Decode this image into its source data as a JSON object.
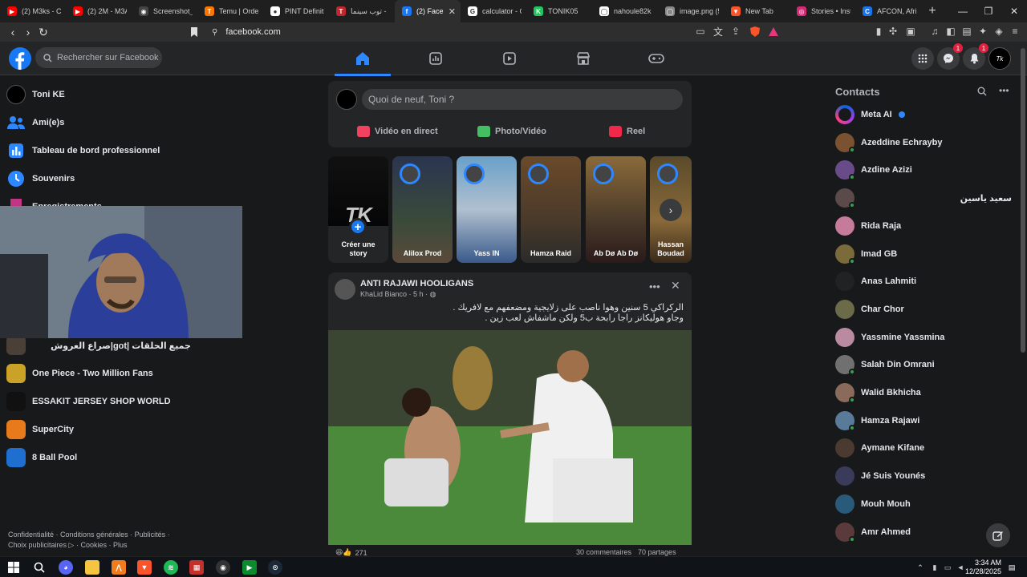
{
  "browser": {
    "tabs": [
      {
        "label": "(2) M3ks - CA",
        "color": "#ff0000",
        "glyph": "▶"
      },
      {
        "label": "(2) 2M - M3A",
        "color": "#ff0000",
        "glyph": "▶"
      },
      {
        "label": "Screenshot_2",
        "color": "#444444",
        "glyph": "◉"
      },
      {
        "label": "Temu | Orders",
        "color": "#fb7701",
        "glyph": "T"
      },
      {
        "label": "PINT Definitio",
        "color": "#ffffff",
        "glyph": "●"
      },
      {
        "label": "توب سينما -",
        "color": "#c0262d",
        "glyph": "T"
      },
      {
        "label": "(2) Faceb",
        "color": "#1877f2",
        "glyph": "f",
        "active": true
      },
      {
        "label": "calculator - G",
        "color": "#ffffff",
        "glyph": "G"
      },
      {
        "label": "TONIK05",
        "color": "#22c55e",
        "glyph": "K"
      },
      {
        "label": "nahoule82k -",
        "color": "#ffffff",
        "glyph": "◯"
      },
      {
        "label": "image.png (5",
        "color": "#888888",
        "glyph": "◯"
      },
      {
        "label": "New Tab",
        "color": "#fb542b",
        "glyph": "▼"
      },
      {
        "label": "Stories • Insta",
        "color": "#d62976",
        "glyph": "◎"
      },
      {
        "label": "AFCON, Africa",
        "color": "#1a73e8",
        "glyph": "C"
      }
    ],
    "url": "facebook.com"
  },
  "header": {
    "search_placeholder": "Rechercher sur Facebook",
    "messenger_badge": "1",
    "notifications_badge": "1"
  },
  "sidebar": {
    "items": [
      {
        "label": "Toni KE",
        "icon": "profile-avatar"
      },
      {
        "label": "Ami(e)s",
        "icon": "friends-icon"
      },
      {
        "label": "Tableau de bord professionnel",
        "icon": "dashboard-icon"
      },
      {
        "label": "Souvenirs",
        "icon": "memories-icon"
      },
      {
        "label": "Enregistrements",
        "icon": "saved-icon"
      }
    ],
    "shortcuts": [
      {
        "label": "صراع العروش|got| جميع الحلقات"
      },
      {
        "label": "One Piece - Two Million Fans"
      },
      {
        "label": "ESSAKIT JERSEY SHOP WORLD"
      },
      {
        "label": "SuperCity"
      },
      {
        "label": "8 Ball Pool"
      }
    ],
    "footer_line1": "Confidentialité · Conditions générales · Publicités ·",
    "footer_line2": "Choix publicitaires ▷ · Cookies · Plus"
  },
  "composer": {
    "placeholder": "Quoi de neuf, Toni ?",
    "live_label": "Vidéo en direct",
    "photo_label": "Photo/Vidéo",
    "reel_label": "Reel"
  },
  "stories": [
    {
      "name": "Créer une story",
      "create": true
    },
    {
      "name": "Alilox Prod"
    },
    {
      "name": "Yass IN"
    },
    {
      "name": "Hamza Raid"
    },
    {
      "name": "Ab Dø Ab Dø"
    },
    {
      "name": "Hassan Boudad"
    }
  ],
  "post": {
    "page_name": "ANTI RAJAWI HOOLIGANS",
    "author": "KhaLid Bianco · 5 h ·",
    "text_line1": "الركراكي 5 سنين وهوا ناصب على زلايجية ومضعفهم مع لافريك .",
    "text_line2": "وجاو هوليكانز راجا رابحة ب5 ولكن ماشفاش لعب زين .",
    "reactions_count": "271",
    "comments": "30 commentaires",
    "shares": "70 partages"
  },
  "contacts": {
    "title": "Contacts",
    "list": [
      {
        "name": "Meta AI",
        "color": "#5b4dff",
        "online": false,
        "verified": true
      },
      {
        "name": "Azeddine Echrayby",
        "color": "#7a5230",
        "online": true
      },
      {
        "name": "Azdine Azizi",
        "color": "#6a4b8a",
        "online": true
      },
      {
        "name": "سعيد ياسين",
        "color": "#5a4a4a",
        "online": true,
        "rtl": true
      },
      {
        "name": "Rida Raja",
        "color": "#c77b9b",
        "online": false
      },
      {
        "name": "Imad GB",
        "color": "#7b6a3a",
        "online": true
      },
      {
        "name": "Anas Lahmiti",
        "color": "#222222",
        "online": false
      },
      {
        "name": "Char Chor",
        "color": "#6b6b4a",
        "online": false
      },
      {
        "name": "Yassmine Yassmina",
        "color": "#b98aa0",
        "online": false
      },
      {
        "name": "Salah Din Omrani",
        "color": "#707070",
        "online": true
      },
      {
        "name": "Walid Bkhicha",
        "color": "#8a6a5a",
        "online": true
      },
      {
        "name": "Hamza Rajawi",
        "color": "#5a7a9a",
        "online": true
      },
      {
        "name": "Aymane Kifane",
        "color": "#4a3a30",
        "online": false
      },
      {
        "name": "Jé Suis Younés",
        "color": "#3a3a5a",
        "online": false
      },
      {
        "name": "Mouh Mouh",
        "color": "#2a5a7a",
        "online": false
      },
      {
        "name": "Amr Ahmed",
        "color": "#5a3a3a",
        "online": true
      }
    ]
  },
  "taskbar": {
    "time": "3:34 AM",
    "date": "12/28/2025"
  }
}
